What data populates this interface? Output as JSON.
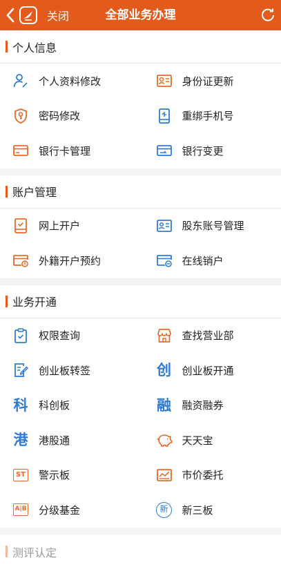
{
  "header": {
    "close_label": "关闭",
    "title": "全部业务办理",
    "accent": "#e25a1c"
  },
  "sections": [
    {
      "title": "个人信息",
      "items": [
        {
          "label": "个人资料修改",
          "icon": "person-edit-icon"
        },
        {
          "label": "身份证更新",
          "icon": "id-card-icon"
        },
        {
          "label": "密码修改",
          "icon": "key-shield-icon"
        },
        {
          "label": "重绑手机号",
          "icon": "phone-icon"
        },
        {
          "label": "银行卡管理",
          "icon": "bank-card-icon"
        },
        {
          "label": "银行变更",
          "icon": "bank-card-change-icon"
        }
      ]
    },
    {
      "title": "账户管理",
      "items": [
        {
          "label": "网上开户",
          "icon": "tablet-check-icon"
        },
        {
          "label": "股东账号管理",
          "icon": "account-card-icon"
        },
        {
          "label": "外籍开户预约",
          "icon": "card-clock-icon"
        },
        {
          "label": "在线销户",
          "icon": "card-remove-icon"
        }
      ]
    },
    {
      "title": "业务开通",
      "items": [
        {
          "label": "权限查询",
          "icon": "clipboard-check-icon"
        },
        {
          "label": "查找营业部",
          "icon": "store-icon"
        },
        {
          "label": "创业板转签",
          "icon": "document-edit-icon"
        },
        {
          "label": "创业板开通",
          "icon": "chuang-glyph-icon",
          "glyph": "创"
        },
        {
          "label": "科创板",
          "icon": "ke-glyph-icon",
          "glyph": "科"
        },
        {
          "label": "融资融券",
          "icon": "rong-glyph-icon",
          "glyph": "融"
        },
        {
          "label": "港股通",
          "icon": "gang-glyph-icon",
          "glyph": "港"
        },
        {
          "label": "天天宝",
          "icon": "piggy-bank-icon"
        },
        {
          "label": "警示板",
          "icon": "st-badge-icon",
          "glyph": "ST"
        },
        {
          "label": "市价委托",
          "icon": "chart-card-icon"
        },
        {
          "label": "分级基金",
          "icon": "ab-badge-icon",
          "glyph": "A|B"
        },
        {
          "label": "新三板",
          "icon": "xin-circle-icon",
          "glyph": "新"
        }
      ]
    },
    {
      "title": "测评认定",
      "items": []
    }
  ]
}
